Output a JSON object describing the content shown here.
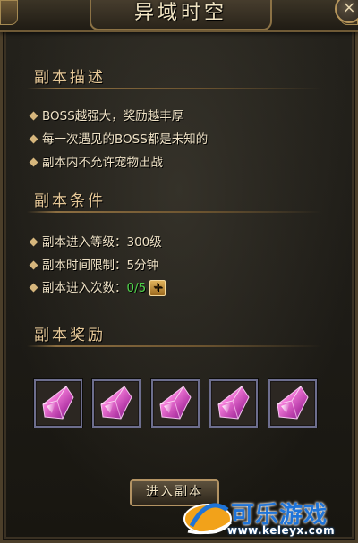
{
  "window": {
    "title": "异域时空"
  },
  "description": {
    "heading": "副本描述",
    "items": [
      "BOSS越强大，奖励越丰厚",
      "每一次遇见的BOSS都是未知的",
      "副本内不允许宠物出战"
    ]
  },
  "conditions": {
    "heading": "副本条件",
    "level_label": "副本进入等级：300级",
    "time_label": "副本时间限制：5分钟",
    "entries_label": "副本进入次数：",
    "entries_count": "0/5",
    "add_icon": "plus-icon"
  },
  "rewards": {
    "heading": "副本奖励",
    "item_icon": "pink-crystal-icon",
    "slot_count": 5
  },
  "actions": {
    "enter_label": "进入副本"
  },
  "watermark": {
    "logo_text": "可乐游戏",
    "url": "www.keleyx.com"
  },
  "colors": {
    "accent_gold": "#e7c998",
    "count_green": "#4fd24a",
    "slot_border": "#6d6e8e"
  }
}
